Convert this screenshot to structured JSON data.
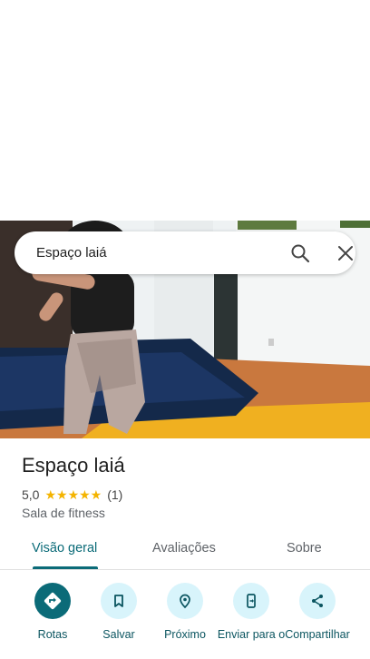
{
  "search": {
    "query": "Espaço laiá"
  },
  "place": {
    "name": "Espaço laiá",
    "rating": "5,0",
    "stars": "★★★★★",
    "review_count": "(1)",
    "category": "Sala de fitness"
  },
  "tabs": [
    {
      "label": "Visão geral",
      "active": true
    },
    {
      "label": "Avaliações",
      "active": false
    },
    {
      "label": "Sobre",
      "active": false
    }
  ],
  "actions": [
    {
      "label": "Rotas",
      "icon": "directions-icon"
    },
    {
      "label": "Salvar",
      "icon": "bookmark-icon"
    },
    {
      "label": "Próximo",
      "icon": "nearby-icon"
    },
    {
      "label": "Enviar para o",
      "icon": "send-to-phone-icon"
    },
    {
      "label": "Compartilhar",
      "icon": "share-icon"
    }
  ],
  "colors": {
    "accent": "#0b6b78",
    "action_bg": "#d8f4fb",
    "star": "#f4b400"
  }
}
